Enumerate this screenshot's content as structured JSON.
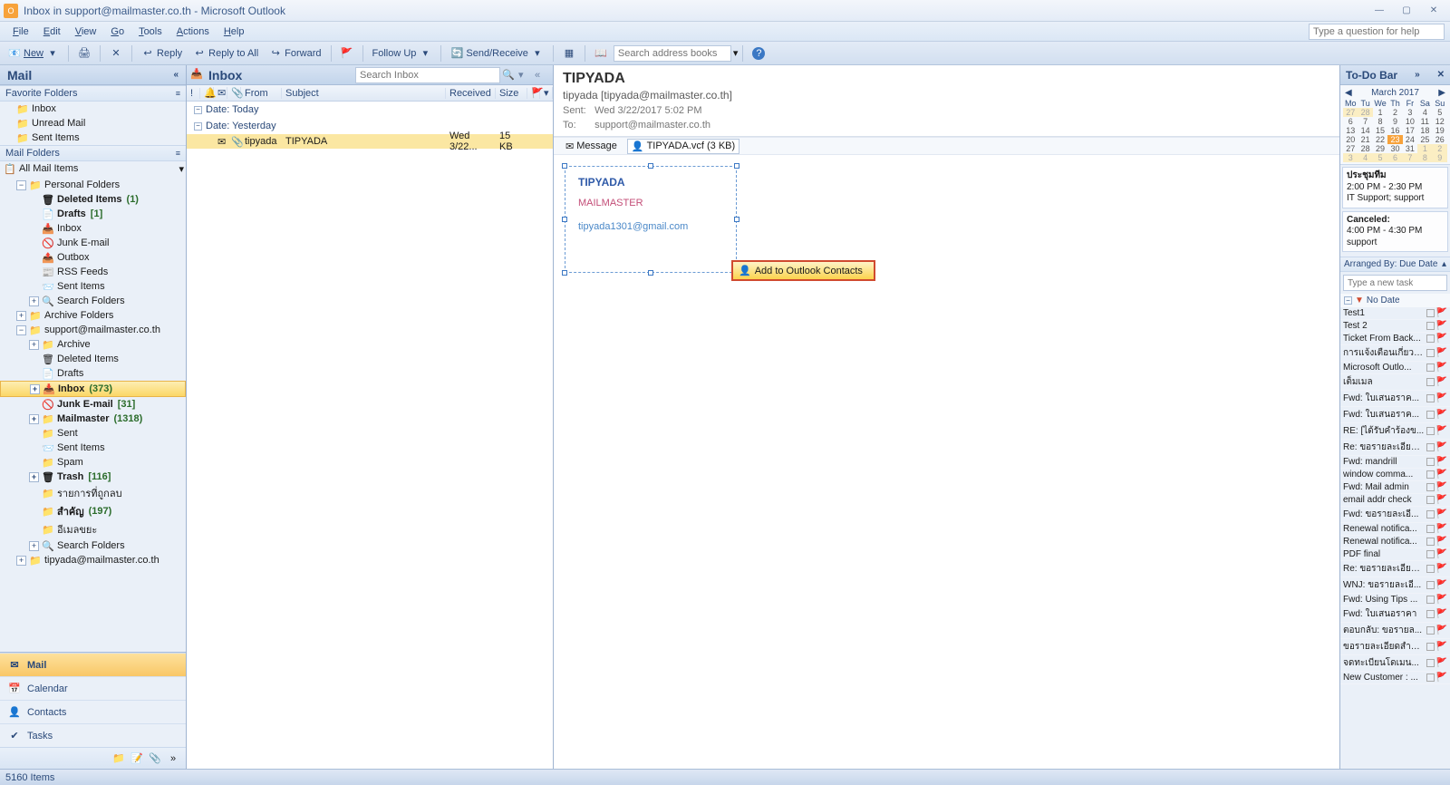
{
  "window": {
    "title": "Inbox in support@mailmaster.co.th - Microsoft Outlook"
  },
  "menubar": [
    "File",
    "Edit",
    "View",
    "Go",
    "Tools",
    "Actions",
    "Help"
  ],
  "helpbox_placeholder": "Type a question for help",
  "toolbar": {
    "new": "New",
    "reply": "Reply",
    "reply_all": "Reply to All",
    "forward": "Forward",
    "followup": "Follow Up",
    "sendreceive": "Send/Receive",
    "search_placeholder": "Search address books"
  },
  "nav": {
    "title": "Mail",
    "fav_hdr": "Favorite Folders",
    "favs": [
      "Inbox",
      "Unread Mail",
      "Sent Items"
    ],
    "mail_hdr": "Mail Folders",
    "all_items": "All Mail Items",
    "tree": [
      {
        "t": "Personal Folders",
        "exp": "-",
        "ind": 0,
        "ic": "📁"
      },
      {
        "t": "Deleted Items",
        "cnt": "(1)",
        "ind": 1,
        "ic": "🗑",
        "bold": true
      },
      {
        "t": "Drafts",
        "cnt": "[1]",
        "ind": 1,
        "ic": "📄",
        "bold": true
      },
      {
        "t": "Inbox",
        "ind": 1,
        "ic": "📥"
      },
      {
        "t": "Junk E-mail",
        "ind": 1,
        "ic": "🚫"
      },
      {
        "t": "Outbox",
        "ind": 1,
        "ic": "📤"
      },
      {
        "t": "RSS Feeds",
        "ind": 1,
        "ic": "📰"
      },
      {
        "t": "Sent Items",
        "ind": 1,
        "ic": "📨"
      },
      {
        "t": "Search Folders",
        "exp": "+",
        "ind": 1,
        "ic": "🔍"
      },
      {
        "t": "Archive Folders",
        "exp": "+",
        "ind": 0,
        "ic": "📁"
      },
      {
        "t": "support@mailmaster.co.th",
        "exp": "-",
        "ind": 0,
        "ic": "📁"
      },
      {
        "t": "Archive",
        "exp": "+",
        "ind": 1,
        "ic": "📁"
      },
      {
        "t": "Deleted Items",
        "ind": 1,
        "ic": "🗑"
      },
      {
        "t": "Drafts",
        "ind": 1,
        "ic": "📄"
      },
      {
        "t": "Inbox",
        "cnt": "(373)",
        "exp": "+",
        "ind": 1,
        "ic": "📥",
        "sel": true,
        "bold": true
      },
      {
        "t": "Junk E-mail",
        "cnt": "[31]",
        "ind": 1,
        "ic": "🚫",
        "bold": true
      },
      {
        "t": "Mailmaster",
        "cnt": "(1318)",
        "exp": "+",
        "ind": 1,
        "ic": "📁",
        "bold": true
      },
      {
        "t": "Sent",
        "ind": 1,
        "ic": "📁"
      },
      {
        "t": "Sent Items",
        "ind": 1,
        "ic": "📨"
      },
      {
        "t": "Spam",
        "ind": 1,
        "ic": "📁"
      },
      {
        "t": "Trash",
        "cnt": "[116]",
        "exp": "+",
        "ind": 1,
        "ic": "🗑",
        "bold": true
      },
      {
        "t": "รายการที่ถูกลบ",
        "ind": 1,
        "ic": "📁"
      },
      {
        "t": "สำคัญ",
        "cnt": "(197)",
        "ind": 1,
        "ic": "📁",
        "bold": true
      },
      {
        "t": "อีเมลขยะ",
        "ind": 1,
        "ic": "📁"
      },
      {
        "t": "Search Folders",
        "exp": "+",
        "ind": 1,
        "ic": "🔍"
      },
      {
        "t": "tipyada@mailmaster.co.th",
        "exp": "+",
        "ind": 0,
        "ic": "📁"
      }
    ],
    "bottom": [
      {
        "t": "Mail",
        "ic": "✉",
        "active": true
      },
      {
        "t": "Calendar",
        "ic": "📅"
      },
      {
        "t": "Contacts",
        "ic": "👤"
      },
      {
        "t": "Tasks",
        "ic": "✔"
      }
    ]
  },
  "list": {
    "title": "Inbox",
    "search_placeholder": "Search Inbox",
    "cols": {
      "from": "From",
      "subject": "Subject",
      "received": "Received",
      "size": "Size"
    },
    "groups": [
      {
        "label": "Date: Today",
        "rows": []
      },
      {
        "label": "Date: Yesterday",
        "rows": [
          {
            "from": "tipyada",
            "subject": "TIPYADA",
            "received": "Wed 3/22...",
            "size": "15 KB",
            "att": true
          }
        ]
      }
    ]
  },
  "read": {
    "subject": "TIPYADA",
    "from": "tipyada [tipyada@mailmaster.co.th]",
    "sent_lbl": "Sent:",
    "sent": "Wed 3/22/2017 5:02 PM",
    "to_lbl": "To:",
    "to": "support@mailmaster.co.th",
    "att_msg": "Message",
    "att_file": "TIPYADA.vcf (3 KB)",
    "vcard": {
      "name": "TIPYADA",
      "company": "MAILMASTER",
      "email": "tipyada1301@gmail.com"
    },
    "addcontacts": "Add to Outlook Contacts"
  },
  "todo": {
    "title": "To-Do Bar",
    "cal": {
      "month": "March 2017",
      "dh": [
        "Mo",
        "Tu",
        "We",
        "Th",
        "Fr",
        "Sa",
        "Su"
      ],
      "weeks": [
        [
          "27",
          "28",
          "1",
          "2",
          "3",
          "4",
          "5"
        ],
        [
          "6",
          "7",
          "8",
          "9",
          "10",
          "11",
          "12"
        ],
        [
          "13",
          "14",
          "15",
          "16",
          "17",
          "18",
          "19"
        ],
        [
          "20",
          "21",
          "22",
          "23",
          "24",
          "25",
          "26"
        ],
        [
          "27",
          "28",
          "29",
          "30",
          "31",
          "1",
          "2"
        ],
        [
          "3",
          "4",
          "5",
          "6",
          "7",
          "8",
          "9"
        ]
      ],
      "today": "23",
      "prev": [
        "27",
        "28"
      ],
      "nextdays": [
        "1",
        "2",
        "3",
        "4",
        "5",
        "6",
        "7",
        "8",
        "9"
      ]
    },
    "appts": [
      {
        "title": "ประชุมทีม",
        "time": "2:00 PM - 2:30 PM",
        "loc": "IT Support; support"
      },
      {
        "title": "Canceled:",
        "time": "4:00 PM - 4:30 PM",
        "loc": "support"
      }
    ],
    "arranged": "Arranged By: Due Date",
    "newtask_placeholder": "Type a new task",
    "group": "No Date",
    "tasks": [
      "Test1",
      "Test 2",
      "Ticket From Back...",
      "การแจ้งเตือนเกี่ยวก...",
      "Microsoft Outlo...",
      "เต็มเมล",
      "Fwd: ใบเสนอราค...",
      "Fwd: ใบเสนอราค...",
      "RE: [ได้รับคำร้องข...",
      "Re: ขอรายละเอียด...",
      "Fwd: mandrill",
      "window comma...",
      "Fwd: Mail admin",
      "email addr check",
      "Fwd: ขอรายละเอี...",
      "Renewal notifica...",
      "Renewal notifica...",
      "PDF final",
      "Re: ขอรายละเอียด...",
      "WNJ: ขอรายละเอี...",
      "Fwd: Using Tips ...",
      "Fwd: ใบเสนอราคา",
      "ตอบกลับ: ขอรายล...",
      "ขอรายละเอียดสำห...",
      "จดทะเบียนโดเมน...",
      "New Customer : ..."
    ]
  },
  "status": "5160 Items"
}
